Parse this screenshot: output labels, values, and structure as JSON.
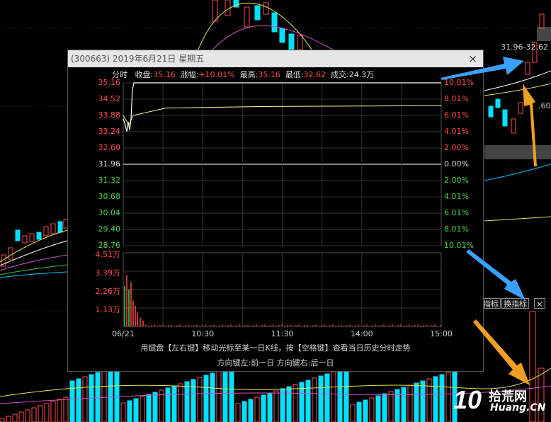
{
  "popup": {
    "title": "(300663) 2019年6月21日 星期五",
    "close_symbol": "×",
    "info": {
      "label_fenshi": "分时",
      "label_close": "收盘:",
      "close": "35.16",
      "label_change": "涨幅:",
      "change": "+10.01%",
      "label_high": "最高:",
      "high": "35.16",
      "label_low": "最低:",
      "low": "32.62",
      "label_volume": "成交:",
      "volume": "24.3万"
    },
    "price_ticks": [
      "35.16",
      "34.52",
      "33.88",
      "33.24",
      "32.60",
      "31.96",
      "31.32",
      "30.68",
      "30.04",
      "29.40",
      "28.76"
    ],
    "pct_ticks": [
      "10.01%",
      "8.01%",
      "6.01%",
      "4.01%",
      "2.00%",
      "0.00%",
      "2.00%",
      "4.01%",
      "6.01%",
      "8.01%",
      "10.01%"
    ],
    "vol_ticks": [
      "4.51万",
      "3.39万",
      "2.26万",
      "1.13万"
    ],
    "time_ticks": [
      "06/21",
      "10:30",
      "11:30",
      "14:00",
      "15:00"
    ],
    "footer_line1": "用键盘【左右键】移动光标至某一日K线，按【空格键】查看当日历史分时走势",
    "footer_line2": "方向键左:前一日   方向键右:后一日"
  },
  "side": {
    "range_label": "31.96-32.62",
    "partial_label": ".60",
    "btn_indicator": "指标",
    "btn_switch": "换指标",
    "btn_close": "×"
  },
  "watermark": {
    "num": "10",
    "cn": "拾荒网",
    "en": "Huang.CN"
  },
  "colors": {
    "up": "#ff4b4b",
    "down": "#00e0ff",
    "neutral": "#dddddd",
    "green_tick": "#4cd24c",
    "price_line": "#ffff99",
    "arrow_blue": "#3aa0ff",
    "arrow_orange": "#f0a020"
  }
}
